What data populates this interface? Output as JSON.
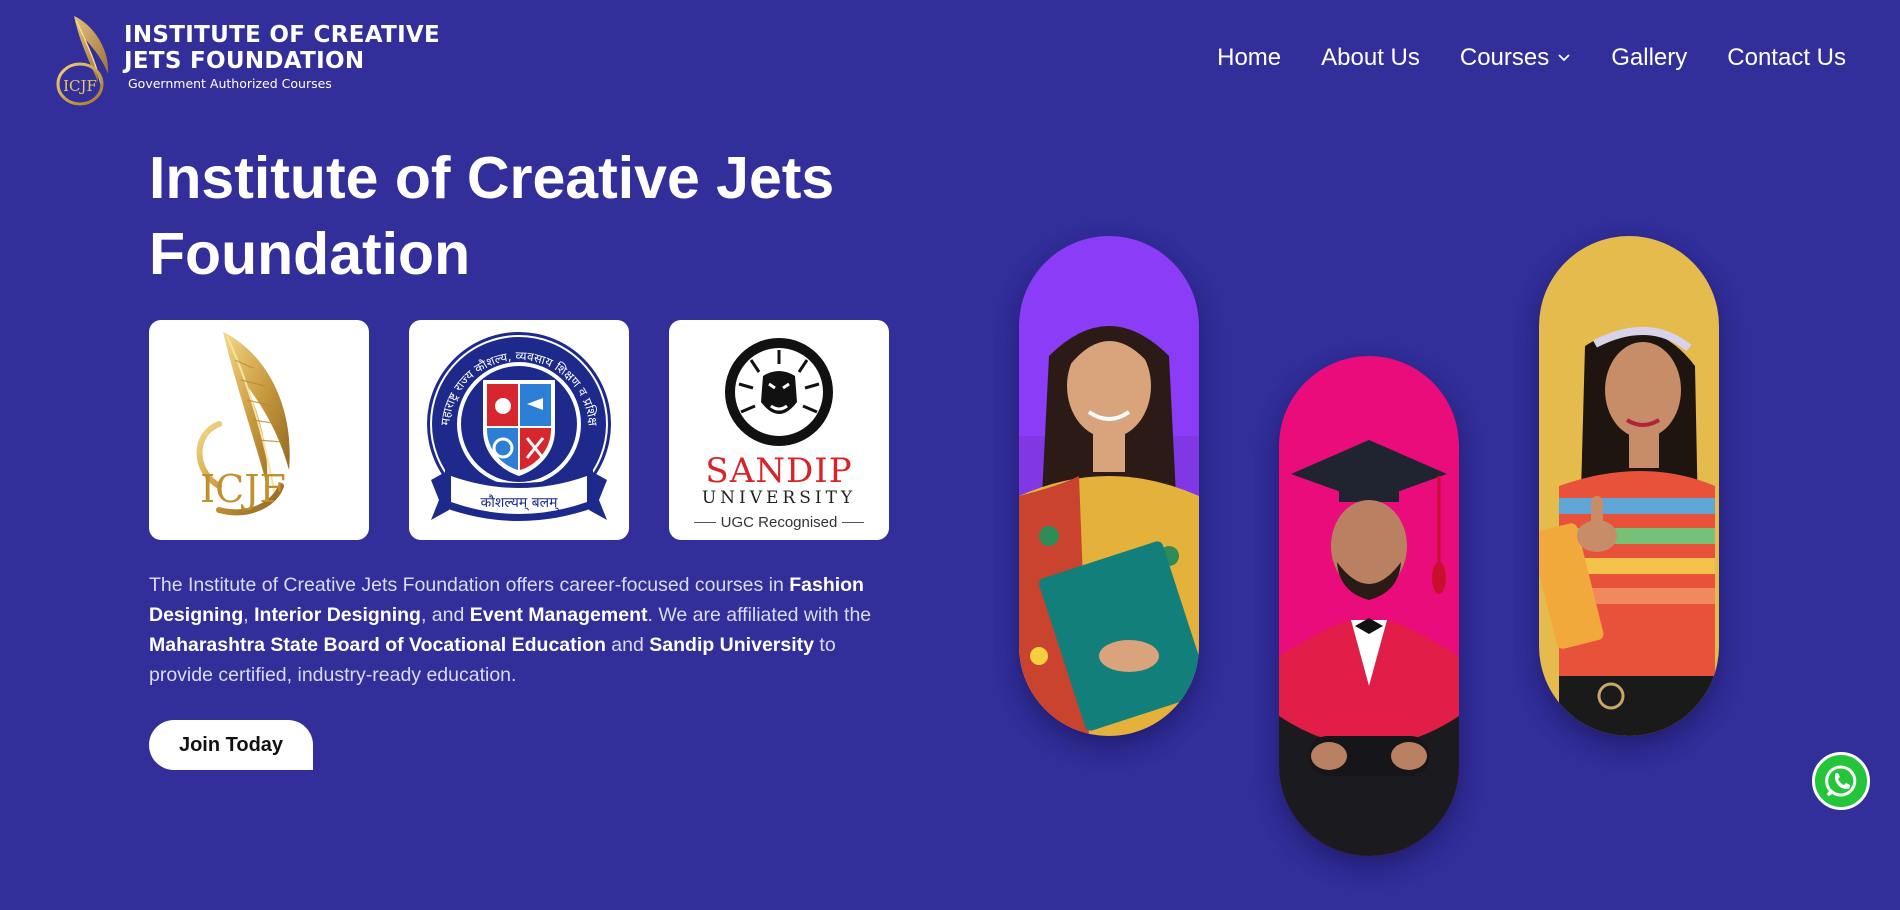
{
  "brand": {
    "logo_line1": "INSTITUTE OF CREATIVE",
    "logo_line2": "JETS FOUNDATION",
    "tagline": "Government Authorized Courses",
    "mark_text": "ICJF"
  },
  "nav": {
    "items": [
      "Home",
      "About Us",
      "Courses",
      "Gallery",
      "Contact Us"
    ]
  },
  "hero": {
    "title": "Institute of Creative Jets Foundation",
    "description_parts": [
      {
        "text": "The Institute of Creative Jets Foundation offers career-focused courses in ",
        "bold": false
      },
      {
        "text": "Fashion Designing",
        "bold": true
      },
      {
        "text": ", ",
        "bold": false
      },
      {
        "text": "Interior Designing",
        "bold": true
      },
      {
        "text": ", and ",
        "bold": false
      },
      {
        "text": "Event Management",
        "bold": true
      },
      {
        "text": ". We are affiliated with the ",
        "bold": false
      },
      {
        "text": "Maharashtra State Board of Vocational Education",
        "bold": true
      },
      {
        "text": " and ",
        "bold": false
      },
      {
        "text": "Sandip University",
        "bold": true
      },
      {
        "text": " to provide certified, industry-ready education.",
        "bold": false
      }
    ],
    "cta_label": "Join Today"
  },
  "affiliations": {
    "icjf_text": "ICJF",
    "msbve_ribbon": "कौशल्यम् बलम्",
    "msbve_ring": "महाराष्ट्र राज्य कौशल्य, व्यवसाय शिक्षण व प्रशिक्षण मंडळ",
    "sandip_name": "SANDIP",
    "sandip_sub": "UNIVERSITY",
    "sandip_tag": "UGC Recognised"
  },
  "colors": {
    "background": "#322e9a",
    "pill_purple": "#8b3cf7",
    "pill_pink": "#ea0c7a",
    "pill_yellow": "#e6bb4e",
    "whatsapp": "#24c53b"
  },
  "icons": {
    "courses_dropdown": "chevron-down-icon",
    "whatsapp": "whatsapp-icon"
  }
}
